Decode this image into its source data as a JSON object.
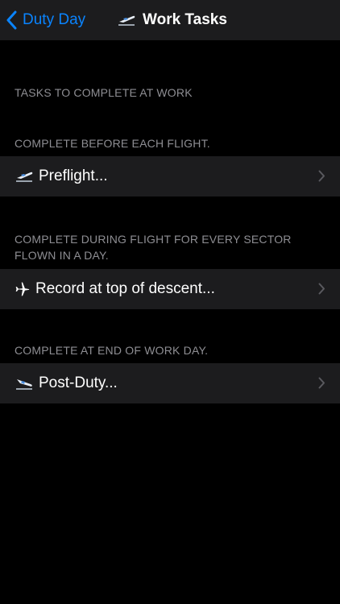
{
  "nav": {
    "back_label": "Duty Day",
    "title": "Work Tasks",
    "back_icon": "chevron-left-icon",
    "title_icon": "plane-departure-icon"
  },
  "colors": {
    "accent": "#0a84ff",
    "background": "#000000",
    "cell": "#1c1c1e",
    "secondary_text": "#8e8e93"
  },
  "sections": [
    {
      "header": "TASKS TO COMPLETE AT WORK"
    },
    {
      "header": "COMPLETE BEFORE EACH FLIGHT.",
      "row": {
        "label": "Preflight...",
        "icon": "plane-departure-icon"
      }
    },
    {
      "header": "COMPLETE DURING FLIGHT FOR EVERY SECTOR FLOWN IN A DAY.",
      "row": {
        "label": "Record at top of descent...",
        "icon": "airplane-icon"
      }
    },
    {
      "header": "COMPLETE AT END OF WORK DAY.",
      "row": {
        "label": "Post-Duty...",
        "icon": "plane-arrival-icon"
      }
    }
  ]
}
